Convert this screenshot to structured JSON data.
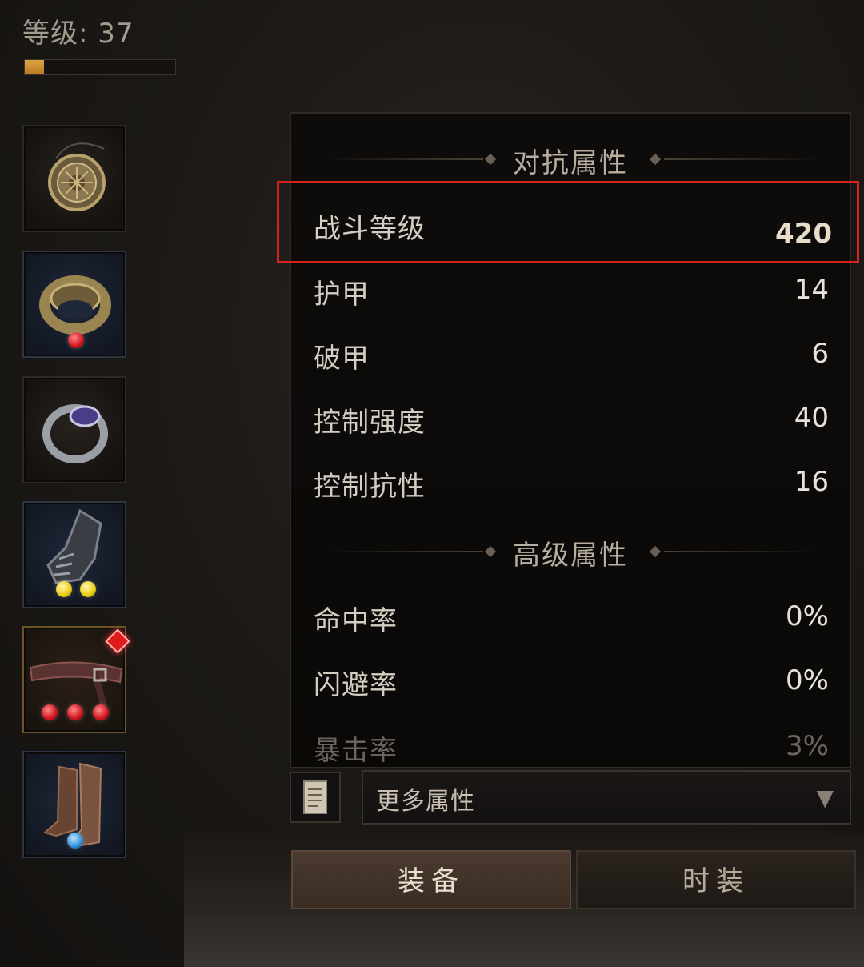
{
  "header": {
    "level_text": "等级: 37",
    "xp_progress": 0.13
  },
  "equipment_slots": [
    {
      "item": "amulet-icon",
      "gems": []
    },
    {
      "item": "ring-icon",
      "gems": [
        "red"
      ]
    },
    {
      "item": "ring-icon",
      "gems": []
    },
    {
      "item": "gauntlet-icon",
      "gems": [
        "yellow",
        "yellow"
      ]
    },
    {
      "item": "belt-icon",
      "gems": [
        "red",
        "red",
        "red"
      ],
      "marker": "red-diamond"
    },
    {
      "item": "boots-icon",
      "gems": [
        "blue"
      ]
    }
  ],
  "stats_panel": {
    "pvp_section_title": "对抗属性",
    "pvp_stats": [
      {
        "label": "战斗等级",
        "value": "420"
      },
      {
        "label": "护甲",
        "value": "14"
      },
      {
        "label": "破甲",
        "value": "6"
      },
      {
        "label": "控制强度",
        "value": "40"
      },
      {
        "label": "控制抗性",
        "value": "16"
      }
    ],
    "advanced_section_title": "高级属性",
    "advanced_stats": [
      {
        "label": "命中率",
        "value": "0%"
      },
      {
        "label": "闪避率",
        "value": "0%"
      },
      {
        "label": "暴击率",
        "value": "3%"
      }
    ]
  },
  "more_attributes": {
    "label": "更多属性",
    "arrow": "▼"
  },
  "tabs": [
    {
      "label": "装备",
      "active": true
    },
    {
      "label": "时装",
      "active": false
    }
  ],
  "colors": {
    "highlight": "#d12420",
    "xp_fill": "#d99a3c"
  }
}
